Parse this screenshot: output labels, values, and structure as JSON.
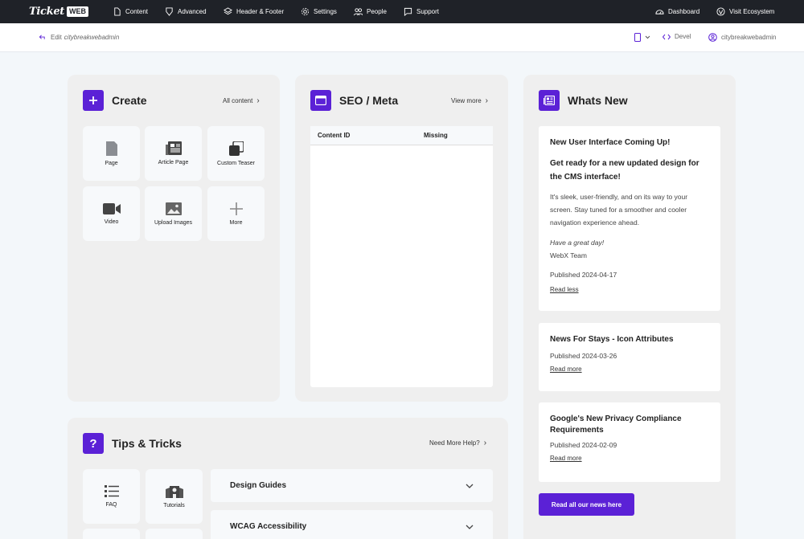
{
  "topbar": {
    "logo_text": "Ticket",
    "logo_badge": "WEB",
    "nav": [
      "Content",
      "Advanced",
      "Header & Footer",
      "Settings",
      "People",
      "Support"
    ],
    "dashboard": "Dashboard",
    "visit": "Visit Ecosystem"
  },
  "subbar": {
    "edit_prefix": "Edit",
    "edit_user": "citybreakwebadmin",
    "devel": "Devel",
    "username": "citybreakwebadmin"
  },
  "create": {
    "title": "Create",
    "link": "All content",
    "tiles": [
      "Page",
      "Article Page",
      "Custom Teaser",
      "Video",
      "Upload Images",
      "More"
    ]
  },
  "seo": {
    "title": "SEO / Meta",
    "link": "View more",
    "columns": [
      "Content ID",
      "Missing"
    ]
  },
  "whatsnew": {
    "title": "Whats New",
    "items": [
      {
        "title": "New User Interface Coming Up!",
        "subtitle": "Get ready for a new updated design for the CMS interface!",
        "body": "It's sleek, user-friendly, and on its way to your screen. Stay tuned for a smoother and cooler navigation experience ahead.",
        "greeting": "Have a great day!",
        "signature": "WebX Team",
        "published": "Published 2024-04-17",
        "link": "Read less"
      },
      {
        "title": "News For Stays - Icon Attributes",
        "published": "Published 2024-03-26",
        "link": "Read more"
      },
      {
        "title": "Google's New Privacy Compliance Requirements",
        "published": "Published 2024-02-09",
        "link": "Read more"
      }
    ],
    "button": "Read all our news here"
  },
  "tips": {
    "title": "Tips & Tricks",
    "link": "Need More Help?",
    "tiles": [
      "FAQ",
      "Tutorials"
    ],
    "accordions": [
      "Design Guides",
      "WCAG Accessibility"
    ]
  },
  "colors": {
    "accent": "#5b21d6",
    "topbar": "#1f2228",
    "card": "#efefef"
  }
}
